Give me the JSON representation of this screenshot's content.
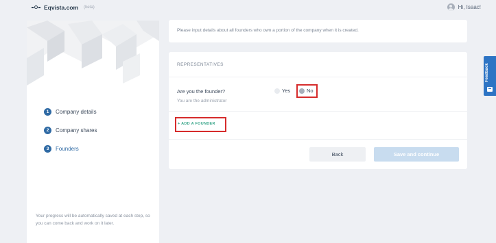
{
  "header": {
    "brand": "Eqvista.com",
    "brand_tag": "(beta)",
    "user_greeting": "Hi, Isaac!"
  },
  "sidebar": {
    "steps": [
      {
        "num": "1",
        "label": "Company details"
      },
      {
        "num": "2",
        "label": "Company shares"
      },
      {
        "num": "3",
        "label": "Founders"
      }
    ],
    "note": "Your progress will be automatically saved at each step, so you can come back and work on it later."
  },
  "intro": {
    "text": "Please input details about all founders who own a portion of the company when it is created."
  },
  "representatives": {
    "title": "REPRESENTATIVES",
    "question": "Are you the founder?",
    "sub": "You are the administrator",
    "option_yes": "Yes",
    "option_no": "No",
    "selected": "No",
    "add_founder": "+ ADD A FOUNDER"
  },
  "actions": {
    "back": "Back",
    "save": "Save and continue"
  },
  "feedback": {
    "label": "Feedback"
  },
  "colors": {
    "accent": "#2f6aa4",
    "highlight": "#d62b2b",
    "add_link": "#3aa68a",
    "save_disabled": "#c8dcef",
    "feedback_tab": "#2d74c4"
  }
}
